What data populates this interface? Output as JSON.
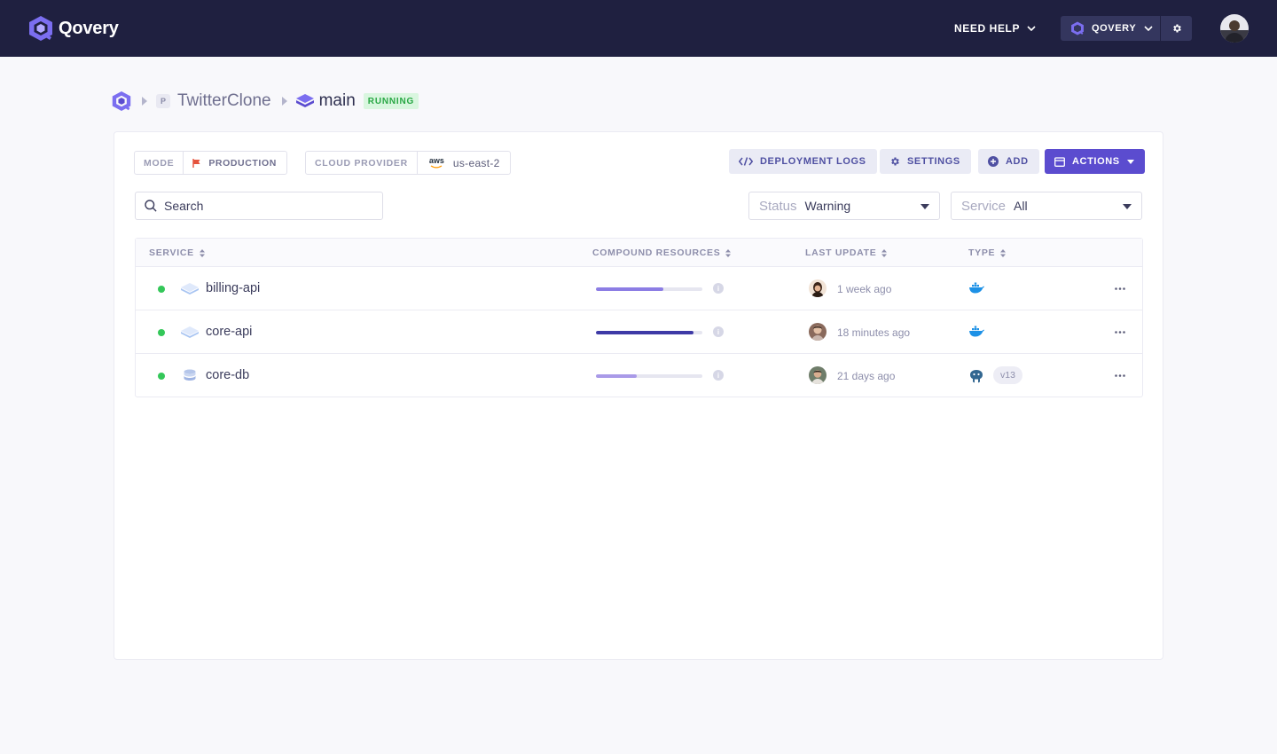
{
  "header": {
    "brand": "Qovery",
    "help_label": "NEED HELP",
    "org_label": "QOVERY"
  },
  "breadcrumb": {
    "project_badge": "P",
    "project": "TwitterClone",
    "environment": "main",
    "status": "RUNNING"
  },
  "toolbar": {
    "mode_key": "MODE",
    "mode_value": "PRODUCTION",
    "provider_key": "CLOUD PROVIDER",
    "provider_logo": "aws",
    "region": "us-east-2",
    "deployment_logs": "DEPLOYMENT LOGS",
    "settings": "SETTINGS",
    "add": "ADD",
    "actions": "ACTIONS"
  },
  "filters": {
    "search_placeholder": "Search",
    "status_key": "Status",
    "status_value": "Warning",
    "service_key": "Service",
    "service_value": "All"
  },
  "table": {
    "columns": [
      "SERVICE",
      "COMPOUND RESOURCES",
      "LAST UPDATE",
      "TYPE"
    ],
    "rows": [
      {
        "name": "billing-api",
        "resources": 0.63,
        "bar_color": "#8c7de4",
        "updated": "1 week ago",
        "type_icon": "docker-icon",
        "version": "",
        "status_color": "#34c759"
      },
      {
        "name": "core-api",
        "resources": 0.92,
        "bar_color": "#3e3aa6",
        "updated": "18 minutes ago",
        "type_icon": "docker-icon",
        "version": "",
        "status_color": "#34c759"
      },
      {
        "name": "core-db",
        "resources": 0.38,
        "bar_color": "#a99ae8",
        "updated": "21 days ago",
        "type_icon": "postgresql-icon",
        "version": "v13",
        "status_color": "#34c759"
      }
    ]
  },
  "colors": {
    "topbar": "#1f2040",
    "primary": "#5b4ccf",
    "running_text": "#29a745",
    "running_bg": "#d9f6df"
  }
}
